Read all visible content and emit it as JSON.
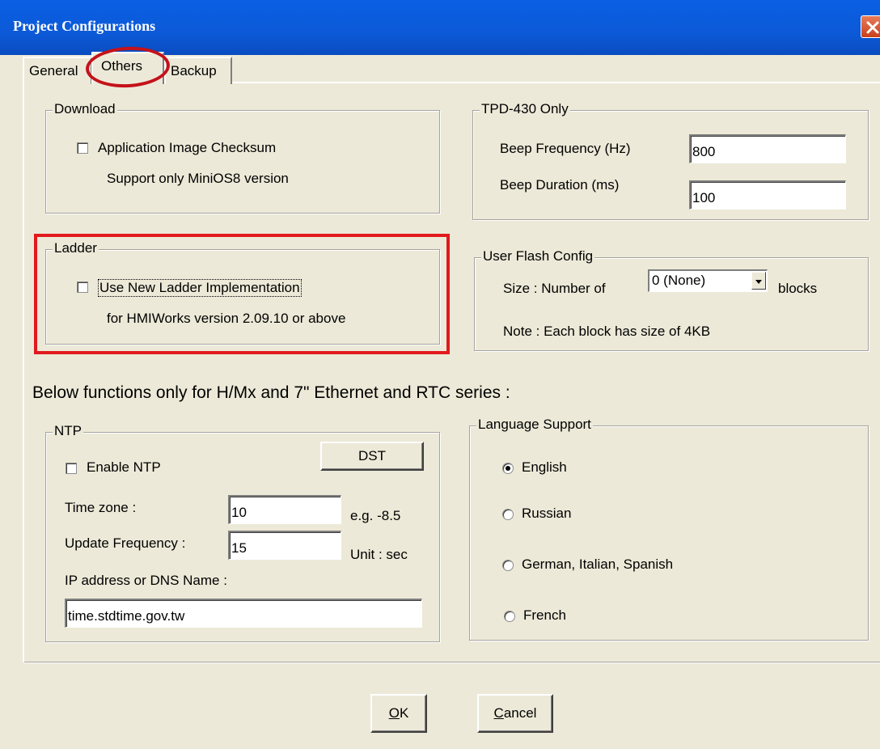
{
  "window": {
    "title": "Project Configurations"
  },
  "tabs": [
    {
      "label": "General",
      "active": false
    },
    {
      "label": "Others",
      "active": true
    },
    {
      "label": "Backup",
      "active": false
    }
  ],
  "download": {
    "title": "Download",
    "checksum_label": "Application Image Checksum",
    "checksum_checked": false,
    "note": "Support only MiniOS8 version"
  },
  "tpd": {
    "title": "TPD-430 Only",
    "beep_freq_label": "Beep Frequency (Hz)",
    "beep_freq_value": "800",
    "beep_dur_label": "Beep Duration (ms)",
    "beep_dur_value": "100"
  },
  "ladder": {
    "title": "Ladder",
    "impl_label": "Use New Ladder Implementation",
    "impl_checked": false,
    "note": "for HMIWorks version 2.09.10 or above"
  },
  "flash": {
    "title": "User Flash Config",
    "size_label": "Size :  Number of",
    "blocks_value": "0 (None)",
    "blocks_unit": "blocks",
    "note": "Note : Each block has size of 4KB"
  },
  "below_note": "Below functions only for H/Mx and 7\" Ethernet and RTC series :",
  "ntp": {
    "title": "NTP",
    "dst_label": "DST",
    "enable_label": "Enable NTP",
    "enable_checked": false,
    "timezone_label": "Time zone :",
    "timezone_value": "10",
    "timezone_hint": "e.g. -8.5",
    "freq_label": "Update Frequency :",
    "freq_value": "15",
    "freq_hint": "Unit : sec",
    "ip_label": "IP address or DNS Name :",
    "ip_value": "time.stdtime.gov.tw"
  },
  "language": {
    "title": "Language Support",
    "options": [
      "English",
      "Russian",
      "German, Italian, Spanish",
      "French"
    ],
    "selected": "English"
  },
  "buttons": {
    "ok": "OK",
    "cancel": "Cancel"
  },
  "colors": {
    "titlebar": "#0a5fe3",
    "dialog_bg": "#ece9d8",
    "highlight_red": "#e11a1e"
  }
}
